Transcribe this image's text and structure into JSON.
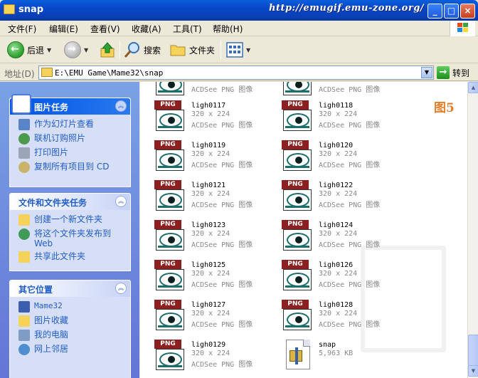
{
  "window": {
    "title": "snap",
    "watermark": "http://emugif.emu-zone.org/",
    "buttons": {
      "minimize": "_",
      "maximize": "□",
      "close": "×"
    }
  },
  "menu": [
    "文件(F)",
    "编辑(E)",
    "查看(V)",
    "收藏(A)",
    "工具(T)",
    "帮助(H)"
  ],
  "toolbar": {
    "back": "后退",
    "search": "搜索",
    "folders": "文件夹"
  },
  "address": {
    "label": "地址(D)",
    "value": "E:\\EMU Game\\Mame32\\snap",
    "go": "转到"
  },
  "left_panels": {
    "picture_tasks": {
      "title": "图片任务",
      "items": [
        "作为幻灯片查看",
        "联机订购照片",
        "打印图片",
        "复制所有项目到 CD"
      ]
    },
    "file_tasks": {
      "title": "文件和文件夹任务",
      "items": [
        "创建一个新文件夹",
        "将这个文件夹发布到",
        "Web",
        "共享此文件夹"
      ]
    },
    "other_places": {
      "title": "其它位置",
      "items": [
        "Mame32",
        "图片收藏",
        "我的电脑",
        "网上邻居"
      ]
    }
  },
  "annotation": "图5",
  "top_partial": {
    "type": "ACDSee PNG 图像"
  },
  "files": [
    {
      "name": "ligh0117",
      "dim": "320 x 224",
      "type": "ACDSee PNG 图像"
    },
    {
      "name": "ligh0118",
      "dim": "320 x 224",
      "type": "ACDSee PNG 图像"
    },
    {
      "name": "ligh0119",
      "dim": "320 x 224",
      "type": "ACDSee PNG 图像"
    },
    {
      "name": "ligh0120",
      "dim": "320 x 224",
      "type": "ACDSee PNG 图像"
    },
    {
      "name": "ligh0121",
      "dim": "320 x 224",
      "type": "ACDSee PNG 图像"
    },
    {
      "name": "ligh0122",
      "dim": "320 x 224",
      "type": "ACDSee PNG 图像"
    },
    {
      "name": "ligh0123",
      "dim": "320 x 224",
      "type": "ACDSee PNG 图像"
    },
    {
      "name": "ligh0124",
      "dim": "320 x 224",
      "type": "ACDSee PNG 图像"
    },
    {
      "name": "ligh0125",
      "dim": "320 x 224",
      "type": "ACDSee PNG 图像"
    },
    {
      "name": "ligh0126",
      "dim": "320 x 224",
      "type": "ACDSee PNG 图像"
    },
    {
      "name": "ligh0127",
      "dim": "320 x 224",
      "type": "ACDSee PNG 图像"
    },
    {
      "name": "ligh0128",
      "dim": "320 x 224",
      "type": "ACDSee PNG 图像"
    },
    {
      "name": "ligh0129",
      "dim": "320 x 224",
      "type": "ACDSee PNG 图像"
    }
  ],
  "zip_file": {
    "name": "snap",
    "size": "5,963 KB"
  },
  "png_badge": "PNG",
  "colors": {
    "title_blue": "#0846c8",
    "task_blue": "#215dc6",
    "png_red": "#8c1f1f",
    "annotation_orange": "#e57d2a"
  }
}
